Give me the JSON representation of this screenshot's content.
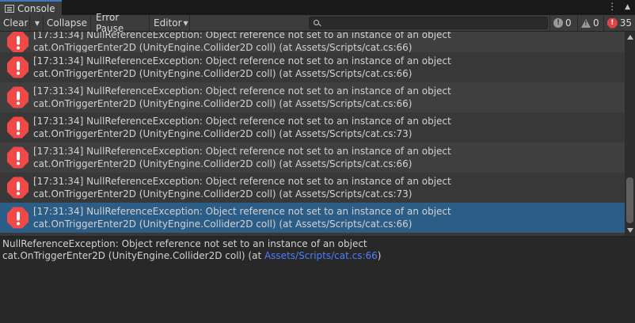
{
  "window": {
    "tab_label": "Console",
    "tab_icon": "console-list-icon",
    "menu_icon": "⋮",
    "maximize_icon": "▲"
  },
  "toolbar": {
    "clear_label": "Clear",
    "collapse_label": "Collapse",
    "error_pause_label": "Error Pause",
    "editor_label": "Editor",
    "search_placeholder": "",
    "info_count": "0",
    "warning_count": "0",
    "error_count": "35"
  },
  "logs": [
    {
      "line1": "[17:31:34] NullReferenceException: Object reference not set to an instance of an object",
      "line2": "cat.OnTriggerEnter2D (UnityEngine.Collider2D coll) (at Assets/Scripts/cat.cs:66)"
    },
    {
      "line1": "[17:31:34] NullReferenceException: Object reference not set to an instance of an object",
      "line2": "cat.OnTriggerEnter2D (UnityEngine.Collider2D coll) (at Assets/Scripts/cat.cs:66)"
    },
    {
      "line1": "[17:31:34] NullReferenceException: Object reference not set to an instance of an object",
      "line2": "cat.OnTriggerEnter2D (UnityEngine.Collider2D coll) (at Assets/Scripts/cat.cs:66)"
    },
    {
      "line1": "[17:31:34] NullReferenceException: Object reference not set to an instance of an object",
      "line2": "cat.OnTriggerEnter2D (UnityEngine.Collider2D coll) (at Assets/Scripts/cat.cs:73)"
    },
    {
      "line1": "[17:31:34] NullReferenceException: Object reference not set to an instance of an object",
      "line2": "cat.OnTriggerEnter2D (UnityEngine.Collider2D coll) (at Assets/Scripts/cat.cs:66)"
    },
    {
      "line1": "[17:31:34] NullReferenceException: Object reference not set to an instance of an object",
      "line2": "cat.OnTriggerEnter2D (UnityEngine.Collider2D coll) (at Assets/Scripts/cat.cs:73)"
    },
    {
      "line1": "[17:31:34] NullReferenceException: Object reference not set to an instance of an object",
      "line2": "cat.OnTriggerEnter2D (UnityEngine.Collider2D coll) (at Assets/Scripts/cat.cs:66)"
    }
  ],
  "selected_index": 6,
  "details": {
    "line1": "NullReferenceException: Object reference not set to an instance of an object",
    "line2_prefix": "cat.OnTriggerEnter2D (UnityEngine.Collider2D coll) (at ",
    "line2_link": "Assets/Scripts/cat.cs:66",
    "line2_suffix": ")"
  },
  "colors": {
    "accent_tab": "#3a79bb",
    "error_red": "#f14848",
    "selected_row": "#2c5d87",
    "link": "#4c7eff"
  }
}
